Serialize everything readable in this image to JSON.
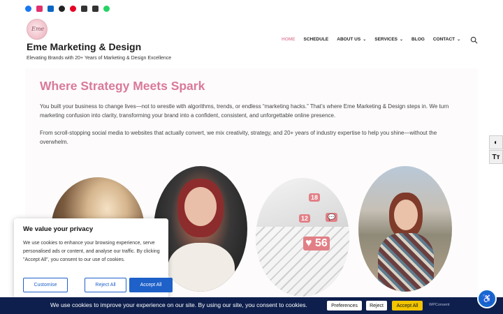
{
  "social": [
    {
      "name": "facebook-icon"
    },
    {
      "name": "instagram-icon"
    },
    {
      "name": "linkedin-icon"
    },
    {
      "name": "threads-icon"
    },
    {
      "name": "pinterest-icon"
    },
    {
      "name": "email-icon"
    },
    {
      "name": "phone-icon"
    },
    {
      "name": "whatsapp-icon"
    }
  ],
  "header": {
    "logo_text": "Eme",
    "site_title": "Eme Marketing & Design",
    "tagline": "Elevating Brands with 20+ Years of Marketing & Design Excellence"
  },
  "nav": {
    "items": [
      {
        "label": "HOME",
        "active": true,
        "dropdown": false
      },
      {
        "label": "SCHEDULE",
        "active": false,
        "dropdown": false
      },
      {
        "label": "ABOUT US",
        "active": false,
        "dropdown": true
      },
      {
        "label": "SERVICES",
        "active": false,
        "dropdown": true
      },
      {
        "label": "BLOG",
        "active": false,
        "dropdown": false
      },
      {
        "label": "CONTACT",
        "active": false,
        "dropdown": true
      }
    ],
    "accent_color": "#e08fa6"
  },
  "main": {
    "headline": "Where Strategy Meets Spark",
    "paragraph_1": "You built your business to change lives—not to wrestle with algorithms, trends, or endless “marketing hacks.” That’s where Eme Marketing & Design steps in. We turn marketing confusion into clarity, transforming your brand into a confident, consistent, and unforgettable online presence.",
    "paragraph_2": "From scroll-stopping social media to websites that actually convert, we mix creativity, strategy, and 20+ years of industry expertise to help you shine—without the overwhelm.",
    "photo_3_counts": [
      "18",
      "12",
      "56"
    ]
  },
  "cookie_popup": {
    "title": "We value your privacy",
    "text": "We use cookies to enhance your browsing experience, serve personalised ads or content, and analyse our traffic. By clicking \"Accept All\", you consent to our use of cookies.",
    "customise_label": "Customise",
    "reject_label": "Reject All",
    "accept_label": "Accept All"
  },
  "cookie_banner": {
    "text": "We use cookies to improve your experience on our site. By using our site, you consent to cookies.",
    "preferences_label": "Preferences",
    "reject_label": "Reject",
    "accept_label": "Accept All",
    "branding": "WPConsent"
  },
  "colors": {
    "headline": "#d9799a",
    "primary_button": "#1e61c9",
    "banner_bg": "#0e1f4d",
    "banner_accept": "#f2c500"
  }
}
